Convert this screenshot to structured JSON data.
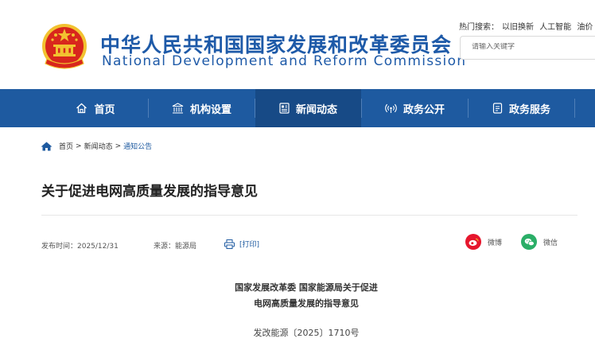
{
  "site": {
    "title_cn": "中华人民共和国国家发展和改革委员会",
    "title_en": "National Development and Reform Commission"
  },
  "search": {
    "hot_label": "热门搜索：",
    "hot_terms": [
      "以旧换新",
      "人工智能",
      "油价"
    ],
    "placeholder": "请输入关键字"
  },
  "nav": {
    "items": [
      {
        "label": "首页",
        "icon": "home-outline-icon"
      },
      {
        "label": "机构设置",
        "icon": "building-icon"
      },
      {
        "label": "新闻动态",
        "icon": "newspaper-icon"
      },
      {
        "label": "政务公开",
        "icon": "broadcast-icon"
      },
      {
        "label": "政务服务",
        "icon": "document-icon"
      }
    ],
    "active_index": 2
  },
  "breadcrumb": {
    "items": [
      "首页",
      "新闻动态",
      "通知公告"
    ],
    "separator": ">"
  },
  "article": {
    "title": "关于促进电网高质量发展的指导意见",
    "publish_time": "发布时间：2025/12/31",
    "source": "来源：能源局",
    "print_label": "[打印]",
    "share": [
      {
        "label": "微博",
        "icon": "weibo-icon",
        "color": "#e6162d"
      },
      {
        "label": "微信",
        "icon": "wechat-icon",
        "color": "#2aae67"
      }
    ],
    "doc_heading_line1": "国家发展改革委 国家能源局关于促进",
    "doc_heading_line2": "电网高质量发展的指导意见",
    "doc_number": "发改能源〔2025〕1710号"
  },
  "colors": {
    "brand_blue": "#1e5aa0",
    "nav_active": "#174a86",
    "emblem_red": "#d8261d",
    "emblem_gold": "#f2c230"
  }
}
